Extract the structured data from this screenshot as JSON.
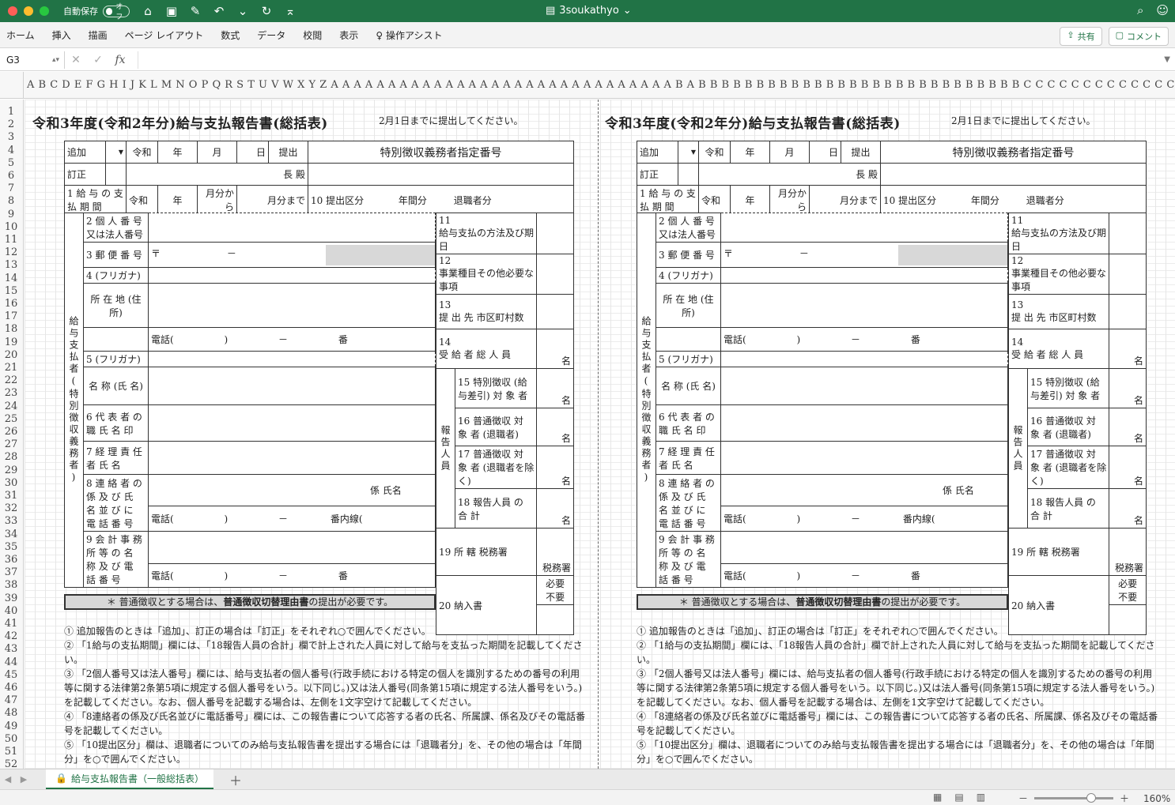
{
  "window": {
    "title": "3soukathyo",
    "autosave_label": "自動保存",
    "autosave_state": "オフ"
  },
  "ribbon": {
    "tabs": [
      "ホーム",
      "挿入",
      "描画",
      "ページ レイアウト",
      "数式",
      "データ",
      "校閲",
      "表示",
      "操作アシスト"
    ],
    "share": "共有",
    "comments": "コメント"
  },
  "formula_bar": {
    "name_box": "G3",
    "fx": "fx",
    "formula": ""
  },
  "column_header": "A  B C  D  E F G H  I  J K L M N  O P Q R S T U V W X Y Z A A A A A A A A A A A A A A A A A A A A A A A A A A A A A A B A B B B B B B B B B B B B B B B B B B B B B B B B B B B B C C C C C C C C C C C C C C C C C C C C C C",
  "rows": [
    "1",
    "2",
    "3",
    "4",
    "5",
    "6",
    "7",
    "8",
    "9",
    "10",
    "11",
    "12",
    "13",
    "14",
    "15",
    "16",
    "17",
    "18",
    "19",
    "20",
    "21",
    "22",
    "23",
    "24",
    "25",
    "26",
    "27",
    "28",
    "29",
    "30",
    "31",
    "32",
    "33",
    "34",
    "35",
    "36",
    "37",
    "38",
    "39",
    "40",
    "41",
    "42",
    "43",
    "44",
    "45",
    "46",
    "47",
    "48",
    "49",
    "50",
    "51",
    "52"
  ],
  "form": {
    "title": "令和3年度(令和2年分)給与支払報告書(総括表)",
    "deadline": "2月1日までに提出してください。",
    "add": "追加",
    "reiwa": "令和",
    "year": "年",
    "month": "月",
    "day": "日",
    "submit": "提出",
    "special_no": "特別徴収義務者指定番号",
    "correct": "訂正",
    "chief": "長 殿",
    "f1": "1 給 与 の 支 払 期 間",
    "from_month": "月分から",
    "to_month": "月分まで",
    "f10": "10 提出区分",
    "annual": "年間分",
    "retired": "退職者分",
    "f2": "2 個 人 番 号 又は法人番号",
    "f3": "3 郵 便 番 号",
    "postal_mark": "〒",
    "dash": "－",
    "f4": "4 (フリガナ)",
    "address": "所 在 地 (住 所)",
    "tel": "電話(",
    "tel_close": ")",
    "ban": "番",
    "f5": "5 (フリガナ)",
    "name": "名 称 (氏 名)",
    "f6": "6 代 表 者 の 職 氏 名 印",
    "f7": "7 経 理 責 任 者 氏 名",
    "f8": "8 連 絡 者 の 係 及 び 氏 名 並 び に 電 話 番 号",
    "section": "係 氏名",
    "ext": "番内線(",
    "f9": "9 会 計 事 務 所 等 の 名 称 及 び 電 話 番 号",
    "f11": "11",
    "f11_label": "給与支払の方法及び期日",
    "f12": "12",
    "f12_label": "事業種目その他必要な事項",
    "f13": "13",
    "f13_label": "提 出 先 市区町村数",
    "f14": "14",
    "f14_label": "受 給 者 総 人 員",
    "mei": "名",
    "report_staff": "報告人員",
    "f15": "15",
    "f15_label": "特別徴収 (給与差引) 対 象 者",
    "f16": "16",
    "f16_label": "普通徴収 対 象 者 (退職者)",
    "f17": "17",
    "f17_label": "普通徴収 対 象 者 (退職者を除く)",
    "f18": "18",
    "f18_label": "報告人員 の 合 計",
    "f19": "19 所 轄 税務署",
    "tax_office": "税務署",
    "f20": "20 納入書",
    "needed": "必要",
    "not_needed": "不要",
    "vertical_label": "給与支払者(特別徴収義務者)",
    "notice_prefix": "＊ 普通徴収とする場合は、",
    "notice_bold": "普通徴収切替理由書",
    "notice_suffix": "の提出が必要です。",
    "notes": [
      "① 追加報告のときは「追加」、訂正の場合は「訂正」をそれぞれ○で囲んでください。",
      "② 「1給与の支払期間」欄には、「18報告人員の合計」欄で計上された人員に対して給与を支払った期間を記載してください。",
      "③ 「2個人番号又は法人番号」欄には、給与支払者の個人番号(行政手続における特定の個人を識別するための番号の利用等に関する法律第2条第5項に規定する個人番号をいう。以下同じ。)又は法人番号(同条第15項に規定する法人番号をいう。)を記載してください。なお、個人番号を記載する場合は、左側を1文字空けて記載してください。",
      "④ 「8連絡者の係及び氏名並びに電話番号」欄には、この報告書について応答する者の氏名、所属課、係名及びその電話番号を記載してください。",
      "⑤ 「10提出区分」欄は、退職者についてのみ給与支払報告書を提出する場合には「退職者分」を、その他の場合は「年間分」を○で囲んでください。"
    ]
  },
  "sheet_tab": "給与支払報告書（一般総括表）",
  "status": {
    "zoom": "160%"
  }
}
